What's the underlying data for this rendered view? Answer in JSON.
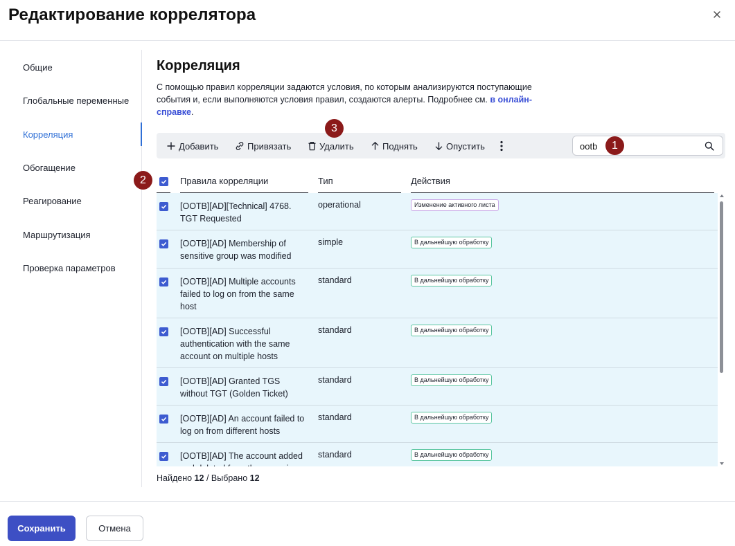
{
  "dialog": {
    "title": "Редактирование коррелятора"
  },
  "sidebar": {
    "items": [
      {
        "label": "Общие",
        "active": false
      },
      {
        "label": "Глобальные переменные",
        "active": false
      },
      {
        "label": "Корреляция",
        "active": true
      },
      {
        "label": "Обогащение",
        "active": false
      },
      {
        "label": "Реагирование",
        "active": false
      },
      {
        "label": "Маршрутизация",
        "active": false
      },
      {
        "label": "Проверка параметров",
        "active": false
      }
    ]
  },
  "section": {
    "title": "Корреляция",
    "description": "С помощью правил корреляции задаются условия, по которым анализируются поступающие события и, если выполняются условия правил, создаются алерты. Подробнее см. ",
    "link_text": "в онлайн-справке",
    "description_end": "."
  },
  "toolbar": {
    "add_label": "Добавить",
    "link_label": "Привязать",
    "delete_label": "Удалить",
    "up_label": "Поднять",
    "down_label": "Опустить"
  },
  "search": {
    "value": "ootb",
    "placeholder": ""
  },
  "callouts": [
    "1",
    "2",
    "3"
  ],
  "table": {
    "columns": [
      "Правила корреляции",
      "Тип",
      "Действия"
    ],
    "rows": [
      {
        "name": "[OOTB][AD][Technical] 4768. TGT Requested",
        "type": "operational",
        "action": "Изменение активного листа",
        "action_kind": "purple"
      },
      {
        "name": "[OOTB][AD] Membership of sensitive group was modified",
        "type": "simple",
        "action": "В дальнейшую обработку",
        "action_kind": "green"
      },
      {
        "name": "[OOTB][AD] Multiple accounts failed to log on from the same host",
        "type": "standard",
        "action": "В дальнейшую обработку",
        "action_kind": "green"
      },
      {
        "name": "[OOTB][AD] Successful authentication with the same account on multiple hosts",
        "type": "standard",
        "action": "В дальнейшую обработку",
        "action_kind": "green"
      },
      {
        "name": "[OOTB][AD] Granted TGS without TGT (Golden Ticket)",
        "type": "standard",
        "action": "В дальнейшую обработку",
        "action_kind": "green"
      },
      {
        "name": "[OOTB][AD] An account failed to log on from different hosts",
        "type": "standard",
        "action": "В дальнейшую обработку",
        "action_kind": "green"
      },
      {
        "name": "[OOTB][AD] The account added and deleted from the group in a",
        "type": "standard",
        "action": "В дальнейшую обработку",
        "action_kind": "green"
      }
    ]
  },
  "footer_status": {
    "found_label": "Найдено",
    "found": "12",
    "separator": "/",
    "selected_label": "Выбрано",
    "selected": "12"
  },
  "buttons": {
    "save": "Сохранить",
    "cancel": "Отмена"
  },
  "colors": {
    "accent": "#2f6fd6",
    "primary_button": "#3d4fc4",
    "row_selected": "#e8f6fc",
    "callout": "#8b1a1a"
  }
}
